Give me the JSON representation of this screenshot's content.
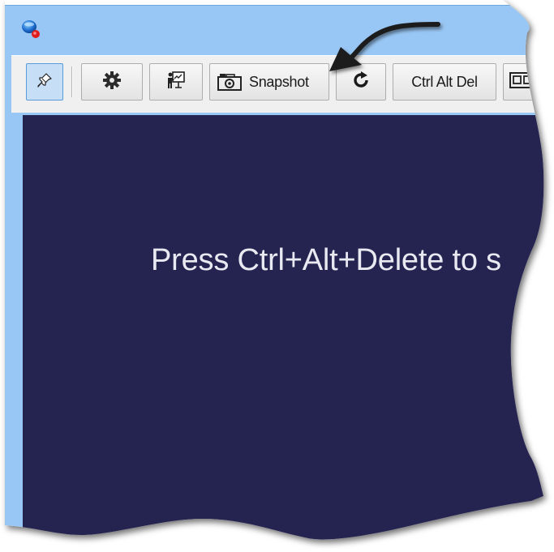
{
  "window": {
    "app_icon": "remote-desktop-globe-icon"
  },
  "toolbar": {
    "pin_icon": "pin-icon",
    "settings_icon": "gear-icon",
    "presentation_icon": "presentation-board-icon",
    "snapshot_icon": "camera-icon",
    "snapshot_label": "Snapshot",
    "refresh_icon": "refresh-icon",
    "ctrl_alt_del_label": "Ctrl Alt Del",
    "multi_monitor_icon": "monitors-icon"
  },
  "remote_screen": {
    "message": "Press Ctrl+Alt+Delete to s"
  },
  "annotation": {
    "arrow": "callout-arrow-icon"
  },
  "colors": {
    "title_bar": "#99c7f5",
    "remote_background": "#252451",
    "toolbar_background": "#f0f0f0",
    "message_text": "#e9e9f2"
  }
}
